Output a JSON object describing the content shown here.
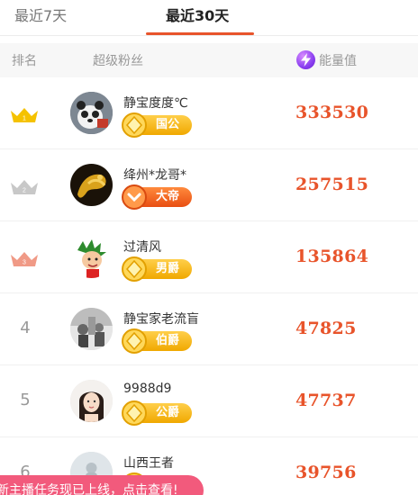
{
  "tabs": [
    {
      "label": "最近7天"
    },
    {
      "label": "最近30天"
    }
  ],
  "header": {
    "rank": "排名",
    "fan": "超级粉丝",
    "energy": "能量值"
  },
  "rows": [
    {
      "rank": "1",
      "name": "静宝度度℃",
      "badge": "国公",
      "energy": "333530",
      "crown": "gold"
    },
    {
      "rank": "2",
      "name": "绛州*龙哥*",
      "badge": "大帝",
      "energy": "257515",
      "crown": "silver"
    },
    {
      "rank": "3",
      "name": "过清风",
      "badge": "男爵",
      "energy": "135864",
      "crown": "bronze"
    },
    {
      "rank": "4",
      "name": "静宝家老流盲",
      "badge": "伯爵",
      "energy": "47825"
    },
    {
      "rank": "5",
      "name": "9988d9",
      "badge": "公爵",
      "energy": "47737"
    },
    {
      "rank": "6",
      "name": "山西王者",
      "badge": "",
      "energy": "39756"
    }
  ],
  "toast": "新主播任务现已上线，点击查看!",
  "colors": {
    "accent": "#e8542b",
    "badge_gold": "#f0a800",
    "toast_bg": "#f25a7c",
    "crown_gold": "#f5c200",
    "crown_silver": "#c8c8c8",
    "crown_bronze": "#f09a86"
  }
}
